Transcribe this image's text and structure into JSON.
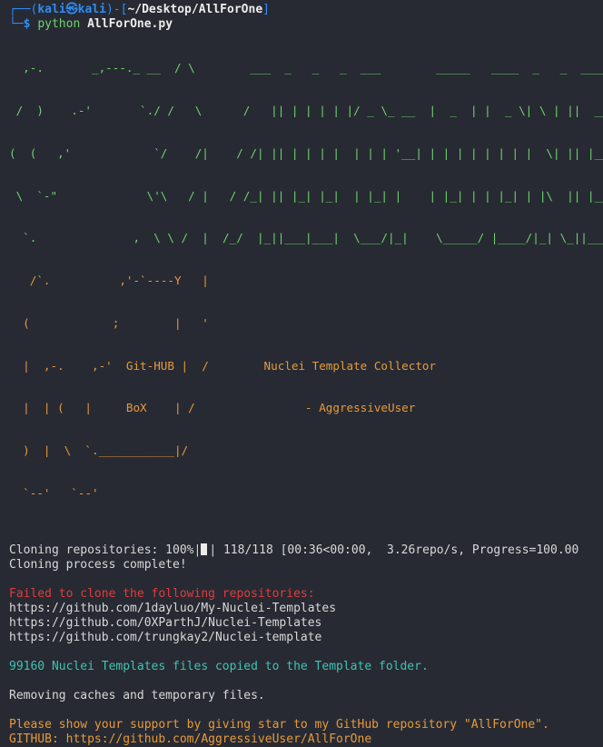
{
  "prompt": {
    "user": "kali",
    "at_symbol": "㉿",
    "host": "kali",
    "path": "~/Desktop/AllForOne",
    "symbol": "$",
    "command_prefix": "python",
    "command_arg": "AllForOne.py"
  },
  "banner": {
    "logo_lines": [
      "  ,-.       _,---._ __  / \\        ___  _   _   _  ___        _____   ____  _   _  ____",
      " /  )    .-'       `./ /   \\      /   || | | | | |/ _ \\_ __  |  _  | |  _ \\| \\ | ||  __|",
      "(  (   ,'            `/    /|    / /| || | | | |  | | | '__| | | | | | | | |  \\| || |__",
      " \\  `-\"             \\'\\   / |   / /_| || |_| |_|  | |_| |    | |_| | | |_| | |\\  || |__",
      "  `.              ,  \\ \\ /  |  /_/  |_||___|___|  \\___/|_|    \\_____/ |____/|_| \\_||____|",
      "   /`.          ,'-`----Y   |",
      "  (            ;        |   '",
      "  |  ,-.    ,-'  Git-HUB |  /        Nuclei Template Collector",
      "  |  | (   |     BoX    | /                - AggressiveUser",
      "  )  |  \\  `.___________|/",
      "  `--'   `--'"
    ],
    "title": "Nuclei Template Collector",
    "author": "- AggressiveUser",
    "git_hub_label": "Git-HUB",
    "box_label": "BoX"
  },
  "progress": {
    "label": "Cloning repositories: 100%|",
    "fraction": 1.0,
    "suffix": "| 118/118 [00:36<00:00,  3.26repo/s, Progress=100.00"
  },
  "output": {
    "clone_complete": "Cloning process complete!",
    "failed_header": "Failed to clone the following repositories:",
    "failed_repos": [
      "https://github.com/1dayluo/My-Nuclei-Templates",
      "https://github.com/0XParthJ/Nuclei-Templates",
      "https://github.com/trungkay2/Nuclei-template"
    ],
    "templates_copied": "99160 Nuclei Templates files copied to the Template folder.",
    "removing_caches": "Removing caches and temporary files.",
    "support_msg": "Please show your support by giving star to my GitHub repository \"AllForOne\".",
    "github_link": "GITHUB: https://github.com/AggressiveUser/AllForOne"
  },
  "colors": {
    "background": "#272a33",
    "prompt_blue": "#2f8cf3",
    "logo_green": "#6fd36d",
    "accent_orange": "#e79a3a",
    "error_red": "#e23b3b",
    "info_cyan": "#3fc3b2"
  }
}
